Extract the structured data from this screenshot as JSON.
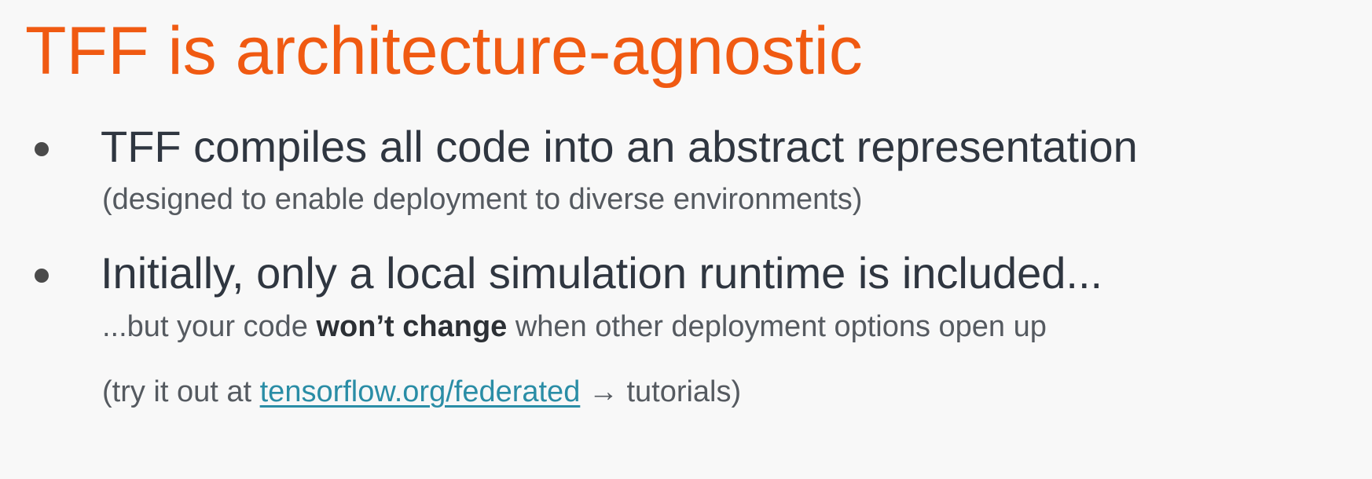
{
  "slide": {
    "title": "TFF is architecture-agnostic",
    "bullets": [
      {
        "text": "TFF compiles all code into an abstract representation",
        "subtext": "(designed to enable deployment to diverse environments)"
      },
      {
        "text": "Initially, only a local simulation runtime is included...",
        "subtext_prefix": "...but your code ",
        "subtext_bold": "won’t change",
        "subtext_suffix": " when other deployment options open up"
      }
    ],
    "footer": {
      "prefix": "(try it out at ",
      "link_text": "tensorflow.org/federated",
      "suffix": " → tutorials)"
    }
  },
  "colors": {
    "title": "#f05a12",
    "body_text": "#2f3640",
    "sub_text": "#555a60",
    "link": "#2a8da6",
    "background": "#f8f8f8"
  }
}
